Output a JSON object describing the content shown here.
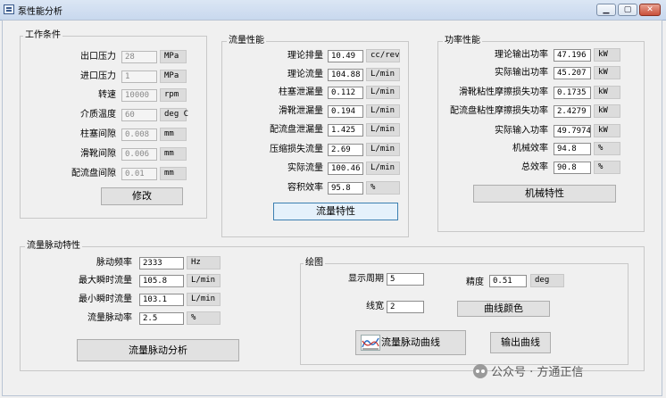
{
  "window": {
    "title": "泵性能分析",
    "min": "▁",
    "max": "▢",
    "close": "✕"
  },
  "work": {
    "legend": "工作条件",
    "rows": [
      {
        "label": "出口压力",
        "value": "28",
        "unit": "MPa"
      },
      {
        "label": "进口压力",
        "value": "1",
        "unit": "MPa"
      },
      {
        "label": "转速",
        "value": "10000",
        "unit": "rpm"
      },
      {
        "label": "介质温度",
        "value": "60",
        "unit": "deg C"
      },
      {
        "label": "柱塞间隙",
        "value": "0.008",
        "unit": "mm"
      },
      {
        "label": "滑靴间隙",
        "value": "0.006",
        "unit": "mm"
      },
      {
        "label": "配流盘间隙",
        "value": "0.01",
        "unit": "mm"
      }
    ],
    "button": "修改"
  },
  "flow": {
    "legend": "流量性能",
    "rows": [
      {
        "label": "理论排量",
        "value": "10.49",
        "unit": "cc/rev"
      },
      {
        "label": "理论流量",
        "value": "104.88",
        "unit": "L/min"
      },
      {
        "label": "柱塞泄漏量",
        "value": "0.112",
        "unit": "L/min"
      },
      {
        "label": "滑靴泄漏量",
        "value": "0.194",
        "unit": "L/min"
      },
      {
        "label": "配流盘泄漏量",
        "value": "1.425",
        "unit": "L/min"
      },
      {
        "label": "压缩损失流量",
        "value": "2.69",
        "unit": "L/min"
      },
      {
        "label": "实际流量",
        "value": "100.46",
        "unit": "L/min"
      },
      {
        "label": "容积效率",
        "value": "95.8",
        "unit": "%"
      }
    ],
    "button": "流量特性"
  },
  "power": {
    "legend": "功率性能",
    "rows": [
      {
        "label": "理论输出功率",
        "value": "47.196",
        "unit": "kW"
      },
      {
        "label": "实际输出功率",
        "value": "45.207",
        "unit": "kW"
      },
      {
        "label": "滑靴粘性摩擦损失功率",
        "value": "0.1735",
        "unit": "kW"
      },
      {
        "label": "配流盘粘性摩擦损失功率",
        "value": "2.4279",
        "unit": "kW"
      },
      {
        "label": "实际输入功率",
        "value": "49.7974",
        "unit": "kW"
      },
      {
        "label": "机械效率",
        "value": "94.8",
        "unit": "%"
      },
      {
        "label": "总效率",
        "value": "90.8",
        "unit": "%"
      }
    ],
    "button": "机械特性"
  },
  "pulse": {
    "legend": "流量脉动特性",
    "rows": [
      {
        "label": "脉动频率",
        "value": "2333",
        "unit": "Hz"
      },
      {
        "label": "最大瞬时流量",
        "value": "105.8",
        "unit": "L/min"
      },
      {
        "label": "最小瞬时流量",
        "value": "103.1",
        "unit": "L/min"
      },
      {
        "label": "流量脉动率",
        "value": "2.5",
        "unit": "%"
      }
    ],
    "button": "流量脉动分析"
  },
  "plot": {
    "legend": "绘图",
    "period_label": "显示周期",
    "period_value": "5",
    "precision_label": "精度",
    "precision_value": "0.51",
    "precision_unit": "deg",
    "linewidth_label": "线宽",
    "linewidth_value": "2",
    "color_button": "曲线颜色",
    "pulse_curve_button": "流量脉动曲线",
    "export_button": "输出曲线"
  },
  "watermark": "公众号 · 方通正信"
}
